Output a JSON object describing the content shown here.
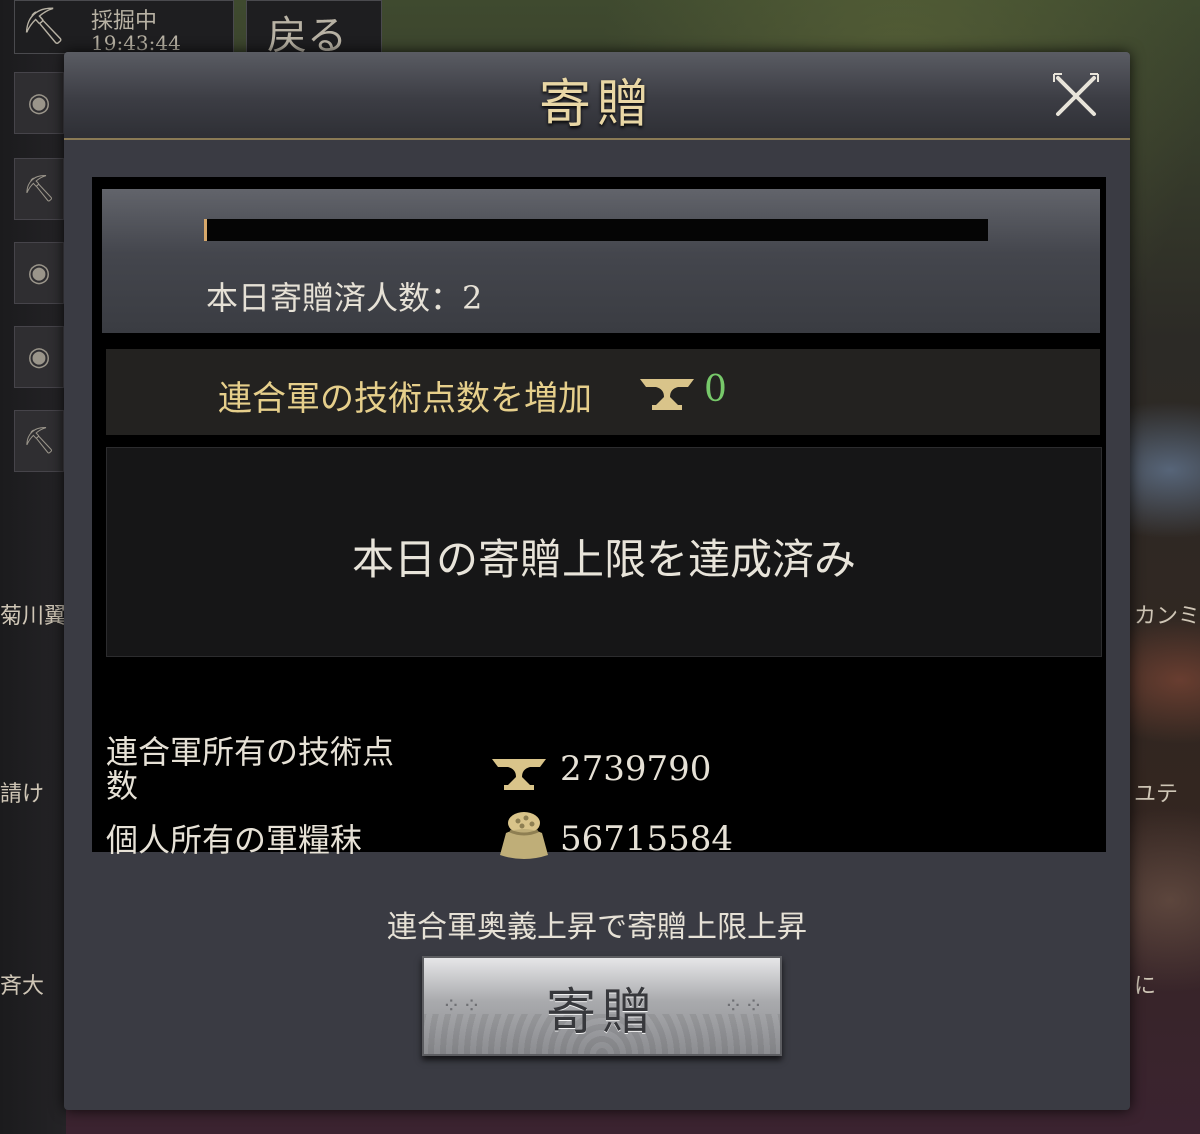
{
  "top_bar": {
    "mining_label": "採掘中",
    "mining_time": "19:43:44",
    "back_label": "戻る"
  },
  "background": {
    "left_names": [
      "菊川翼",
      "請け",
      "斉大"
    ],
    "right_names": [
      "カンミ",
      "ユテ",
      "に"
    ]
  },
  "dialog": {
    "title": "寄贈",
    "progress": {
      "fraction": 0.004,
      "donor_count_text": "本日寄贈済人数：2"
    },
    "bonus": {
      "label": "連合軍の技術点数を増加",
      "icon": "anvil-icon",
      "value": "0"
    },
    "limit_message": "本日の寄贈上限を達成済み",
    "resources": [
      {
        "label": "連合軍所有の技術点数",
        "icon": "anvil-icon",
        "value": "2739790"
      },
      {
        "label": "個人所有の軍糧秣",
        "icon": "grain-sack-icon",
        "value": "56715584"
      }
    ],
    "hint": "連合軍奥義上昇で寄贈上限上昇",
    "donate_button": "寄贈"
  },
  "colors": {
    "title": "#e9d7a5",
    "bonus_label": "#e6cf8b",
    "bonus_value": "#77c96a",
    "progress_fill": "#d7a86b",
    "anvil": "#d9c48a"
  }
}
